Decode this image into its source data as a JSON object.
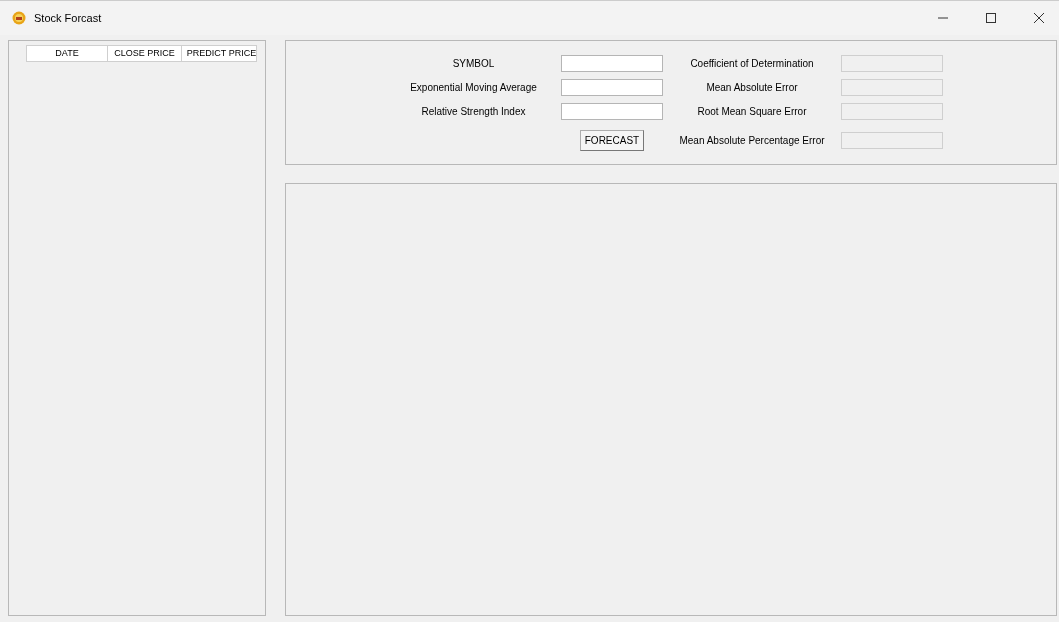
{
  "window": {
    "title": "Stock Forcast"
  },
  "table": {
    "columns": [
      "DATE",
      "CLOSE PRICE",
      "PREDICT PRICE"
    ]
  },
  "form": {
    "rows": [
      {
        "label": "SYMBOL",
        "value": "",
        "metric_label": "Coefficient of Determination",
        "metric_disabled": true
      },
      {
        "label": "Exponential Moving Average",
        "value": "",
        "metric_label": "Mean Absolute Error",
        "metric_disabled": true
      },
      {
        "label": "Relative Strength Index",
        "value": "",
        "metric_label": "Root Mean Square Error",
        "metric_disabled": true
      }
    ],
    "button": "FORECAST",
    "last_metric": {
      "label": "Mean Absolute Percentage Error",
      "disabled": true
    }
  }
}
